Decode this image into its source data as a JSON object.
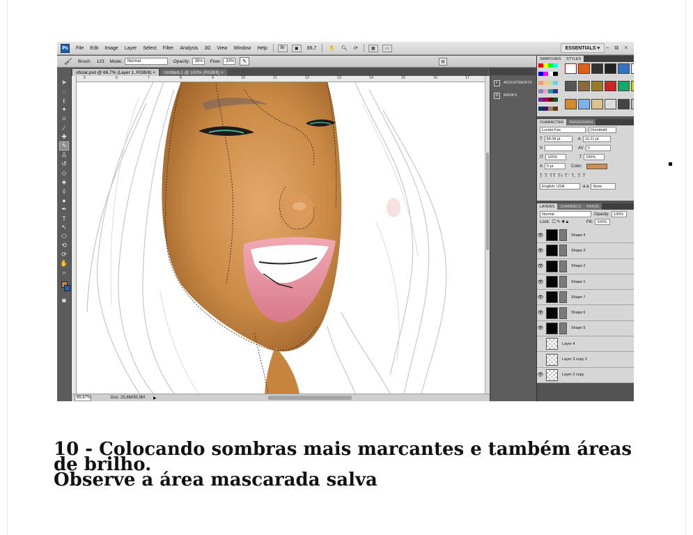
{
  "app": {
    "logo": "Ps",
    "menu": [
      "File",
      "Edit",
      "Image",
      "Layer",
      "Select",
      "Filter",
      "Analysis",
      "3D",
      "View",
      "Window",
      "Help"
    ],
    "zoom_menu": "66,7",
    "workspace": "ESSENTIALS",
    "window_controls": "– ⧉ ×"
  },
  "options_bar": {
    "brush_label": "Brush:",
    "brush_size": "123",
    "mode_label": "Mode:",
    "mode_value": "Normal",
    "opacity_label": "Opacity:",
    "opacity_value": "35%",
    "flow_label": "Flow:",
    "flow_value": "33%"
  },
  "tabs": [
    {
      "label": "oficial.psd @ 66,7% (Layer 1, RGB/8)",
      "close": "×"
    },
    {
      "label": "Untitled-1 @ 100% (RGB/8)",
      "close": "×"
    }
  ],
  "ruler_numbers": [
    "5",
    "6",
    "7",
    "8",
    "9",
    "10",
    "11",
    "12",
    "13",
    "14",
    "15",
    "16",
    "17"
  ],
  "status": {
    "zoom": "66,67%",
    "doc": "Doc: 25,6M/50,5M"
  },
  "dock": [
    {
      "label": "ADJUSTMENTS",
      "icon": "adjustments-icon"
    },
    {
      "label": "MASKS",
      "icon": "masks-icon"
    }
  ],
  "panels": {
    "swatches_tab": "SWATCHES",
    "styles_tab": "STYLES",
    "character_tab": "CHARACTER",
    "paragraph_tab": "PARAGRAPH",
    "font_family": "Lucida Fax",
    "font_style": "Demibold",
    "font_size": "88.08 pt",
    "leading": "16.21 pt",
    "kerning": "",
    "tracking": "0",
    "vscale": "100%",
    "hscale": "100%",
    "baseline": "0 pt",
    "color_label": "Color:",
    "type_buttons": "T T TT Tr T' T, T T",
    "language": "English: USA",
    "aa_label": "a a",
    "antialias": "None",
    "layers_tab": "LAYERS",
    "channels_tab": "CHANNELS",
    "paths_tab": "PATHS",
    "blend_mode": "Normal",
    "opacity_label": "Opacity:",
    "opacity": "100%",
    "lock_label": "Lock:",
    "fill_label": "Fill:",
    "fill": "100%"
  },
  "layers": [
    {
      "name": "Shape 4",
      "visible": true,
      "thumb": "black"
    },
    {
      "name": "Shape 3",
      "visible": true,
      "thumb": "black"
    },
    {
      "name": "Shape 2",
      "visible": true,
      "thumb": "black"
    },
    {
      "name": "Shape 1",
      "visible": true,
      "thumb": "black"
    },
    {
      "name": "Shape 7",
      "visible": true,
      "thumb": "black"
    },
    {
      "name": "Shape 6",
      "visible": true,
      "thumb": "black"
    },
    {
      "name": "Shape 5",
      "visible": true,
      "thumb": "black"
    },
    {
      "name": "Layer 4",
      "visible": false,
      "thumb": "trans"
    },
    {
      "name": "Layer 3 copy 2",
      "visible": false,
      "thumb": "trans"
    },
    {
      "name": "Layer 3 copy",
      "visible": true,
      "thumb": "trans"
    }
  ],
  "caption": {
    "line1": "10 - Colocando sombras mais marcantes e também áreas",
    "line2": "de brilho.",
    "line3": "Observe a área mascarada salva"
  },
  "colors": {
    "foreground": "#c58a4e",
    "background": "#1f63b7",
    "skin": "#d08f4e",
    "lips": "#e38a98"
  }
}
